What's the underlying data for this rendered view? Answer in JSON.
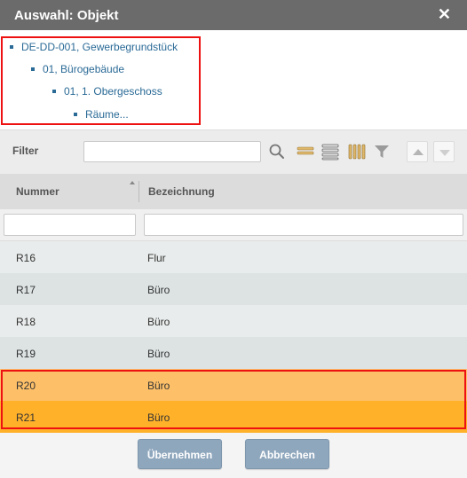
{
  "window": {
    "title": "Auswahl: Objekt",
    "close": "✕"
  },
  "tree": {
    "items": [
      {
        "label": "DE-DD-001, Gewerbegrundstück"
      },
      {
        "label": "01, Bürogebäude"
      },
      {
        "label": "01, 1. Obergeschoss"
      },
      {
        "label": "Räume..."
      }
    ]
  },
  "filter": {
    "label": "Filter",
    "value": "",
    "placeholder": ""
  },
  "toolbar": {
    "icons": [
      "search-icon",
      "compact-rows-icon",
      "expanded-rows-icon",
      "columns-icon",
      "funnel-icon",
      "move-up-icon",
      "move-down-icon"
    ]
  },
  "grid": {
    "columns": [
      "Nummer",
      "Bezeichnung"
    ],
    "rows": [
      {
        "nummer": "R16",
        "bezeichnung": "Flur",
        "selected": false
      },
      {
        "nummer": "R17",
        "bezeichnung": "Büro",
        "selected": false
      },
      {
        "nummer": "R18",
        "bezeichnung": "Büro",
        "selected": false
      },
      {
        "nummer": "R19",
        "bezeichnung": "Büro",
        "selected": false
      },
      {
        "nummer": "R20",
        "bezeichnung": "Büro",
        "selected": true
      },
      {
        "nummer": "R21",
        "bezeichnung": "Büro",
        "selected": true
      }
    ]
  },
  "buttons": {
    "accept": "Übernehmen",
    "cancel": "Abbrechen"
  },
  "colors": {
    "titlebar": "#6b6b6b",
    "link": "#2a6a96",
    "selected_light": "#fdc069",
    "selected_dark": "#ffb12a",
    "highlight_border": "#ee1111",
    "button": "#8fa7bd"
  }
}
